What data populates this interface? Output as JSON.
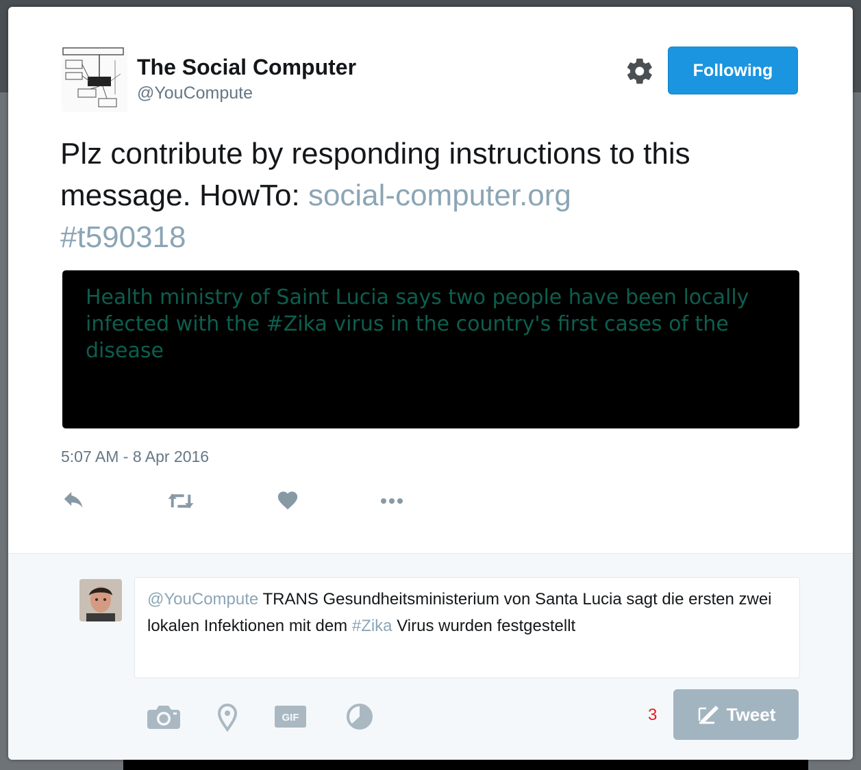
{
  "profile": {
    "display_name": "The Social Computer",
    "handle": "@YouCompute",
    "follow_label": "Following"
  },
  "tweet": {
    "text_plain": "Plz contribute by responding instructions to this message. HowTo:",
    "link_text": "social-computer.org",
    "hashtag": "#t590318",
    "media_text": "Health ministry of Saint Lucia says two people have been locally infected with the #Zika virus in the country's first cases of the disease",
    "timestamp": "5:07 AM - 8 Apr 2016"
  },
  "actions": [
    "reply-icon",
    "retweet-icon",
    "like-icon",
    "more-icon"
  ],
  "reply": {
    "mention": "@YouCompute",
    "text_before_hashtag": "TRANS Gesundheitsministerium von Santa Lucia sagt die ersten zwei lokalen Infektionen mit dem",
    "hashtag": "#Zika",
    "text_after_hashtag": "Virus wurden festgestellt",
    "char_count": "3",
    "tweet_label": "Tweet",
    "tools": [
      "camera-icon",
      "location-icon",
      "gif-icon",
      "poll-icon"
    ]
  },
  "colors": {
    "accent": "#1b95e0",
    "link": "#8ba5b5",
    "media_text": "#0d5e4e",
    "char_count": "#e81c1c",
    "tweet_button_disabled": "#a3b4c1"
  }
}
